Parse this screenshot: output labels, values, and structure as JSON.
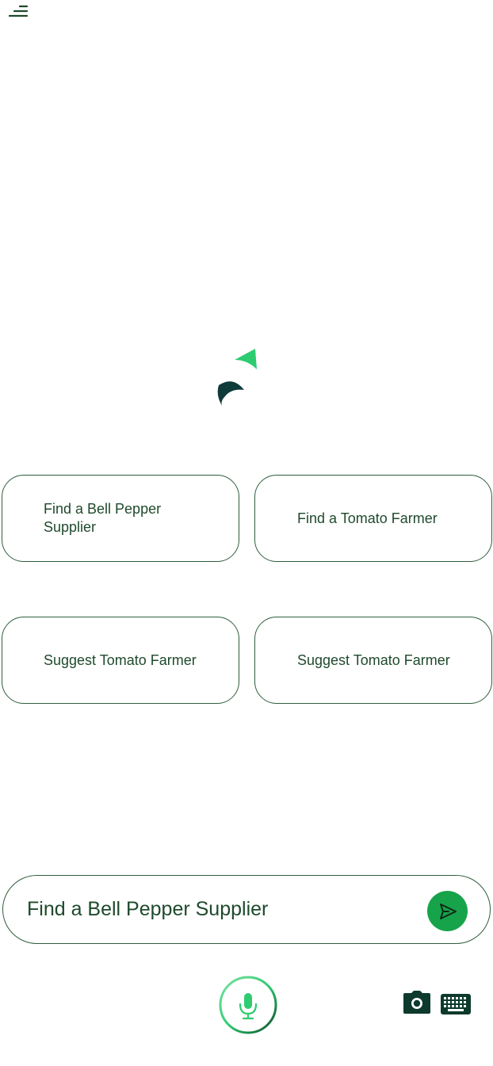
{
  "header": {
    "menu_icon": "menu-icon"
  },
  "logo": {
    "icon": "app-logo",
    "colors": {
      "light": "#2ecc71",
      "dark": "#0f3b3a"
    }
  },
  "suggestions": [
    {
      "label": "Find a Bell Pepper Supplier"
    },
    {
      "label": "Find a Tomato Farmer"
    },
    {
      "label": "Suggest Tomato Farmer"
    },
    {
      "label": "Suggest Tomato Farmer"
    }
  ],
  "chat_input": {
    "value": "Find a Bell Pepper Supplier",
    "send_icon": "send-icon"
  },
  "bottom_bar": {
    "mic_icon": "microphone-icon",
    "camera_icon": "camera-icon",
    "keyboard_icon": "keyboard-icon"
  },
  "colors": {
    "accent": "#17a34a",
    "text": "#1f4a2c",
    "border": "#2f5e3d"
  }
}
